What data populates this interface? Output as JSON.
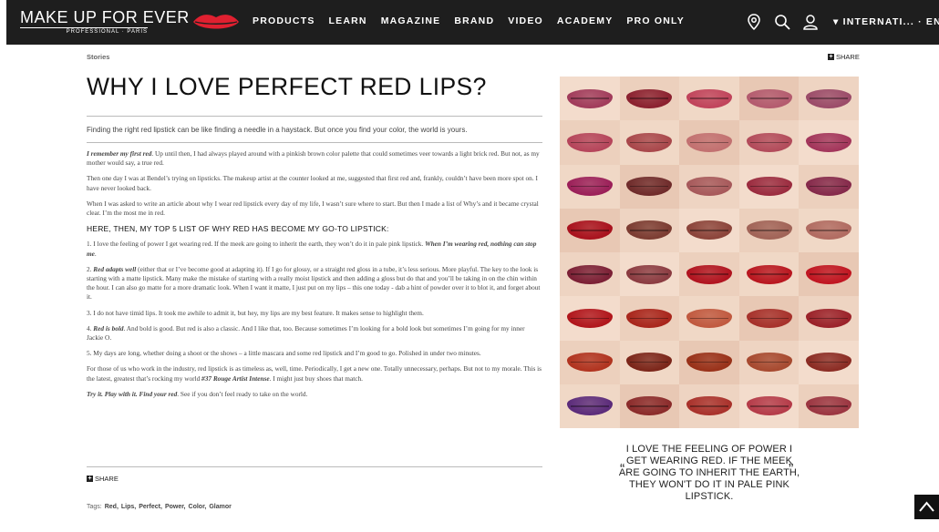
{
  "header": {
    "logo_main": "MAKE UP FOR EVER",
    "logo_sub": "PROFESSIONAL · PARIS",
    "nav": [
      "PRODUCTS",
      "LEARN",
      "MAGAZINE",
      "BRAND",
      "VIDEO",
      "ACADEMY",
      "PRO ONLY"
    ],
    "icons": [
      "location-pin-icon",
      "search-icon",
      "user-icon"
    ],
    "international": "▾ INTERNATI... · EN"
  },
  "article": {
    "breadcrumb": "Stories",
    "share_label": "SHARE",
    "title": "WHY I LOVE PERFECT RED LIPS?",
    "intro": "Finding the right red lipstick can be like finding a needle in a haystack. But once you find your color, the world is yours.",
    "paragraphs": [
      {
        "em": "I remember my first red",
        "text": ". Up until then, I had always played around with a pinkish brown color palette that could sometimes veer towards a light brick red. But not, as my mother would say, a true red."
      },
      {
        "em": "",
        "text": "Then one day I was at Bendel’s trying on lipsticks. The makeup artist at the counter looked at me, suggested that first red and, frankly, couldn’t have been more spot on. I have never looked back."
      },
      {
        "em": "",
        "text": "When I was asked to write an article about why I wear red lipstick every day of my life, I wasn’t sure where to start. But then I made a list of Why’s and it became crystal clear. I’m the most me in red."
      }
    ],
    "subheading": "HERE, THEN, MY TOP 5 LIST OF WHY RED HAS BECOME MY GO-TO LIPSTICK:",
    "list": [
      {
        "pre": "1. I love the feeling of power I get wearing red. If the meek are going to inherit the earth, they won’t do it in pale pink lipstick. ",
        "em": "When I’m wearing red, nothing can stop me",
        "post": "."
      },
      {
        "pre": "2. ",
        "em": "Red adapts well",
        "post": " (either that or I’ve become good at adapting it). If I go for glossy, or a straight red gloss in a tube, it’s less serious. More playful. The key to the look is starting with a matte lipstick. Many make the mistake of starting with a really moist lipstick and then adding a gloss but do that and you’ll be taking in on the chin within the hour. I can also go matte for a more dramatic look. When I want it matte, I just put on my lips – this one today  - dab a hint of powder over it to blot it, and forget about it."
      },
      {
        "pre": "3. I do not have timid lips. It took me awhile to admit it, but hey, my lips are my best feature. It makes sense to highlight them.",
        "em": "",
        "post": ""
      },
      {
        "pre": "4. ",
        "em": "Red is bold",
        "post": ". And bold is good. But red is also a classic. And I like that, too. Because sometimes I’m looking for a bold look but sometimes I’m going for my inner Jackie O."
      },
      {
        "pre": "5. My days are long, whether doing a shoot or the shows – a little mascara and some red lipstick and I’m good to go. Polished in under two minutes.",
        "em": "",
        "post": ""
      }
    ],
    "closing": {
      "pre": "For those of us who work in the industry, red lipstick is as timeless as, well, time. Periodically, I get a new one. Totally unnecessary, perhaps. But not to my morale. This is the latest, greatest that’s rocking my world  ",
      "em": "#37 Rouge Artist Intense",
      "post": ". I might just buy shoes that match."
    },
    "final": {
      "em": "Try it. Play with it. Find your red",
      "post": ". See if you don’t feel ready to take on the world."
    },
    "tags_label": "Tags:",
    "tags": [
      "Red,",
      "Lips,",
      "Perfect,",
      "Power,",
      "Color,",
      "Glamor"
    ]
  },
  "swatches": [
    "#a03a5a",
    "#8a1f2e",
    "#c0425a",
    "#b35a6e",
    "#9a4a68",
    "#b5445a",
    "#a8464a",
    "#c27070",
    "#b24a5a",
    "#a2345a",
    "#9a1e58",
    "#6e2a2a",
    "#a6585a",
    "#9a2a3e",
    "#84284a",
    "#a8101c",
    "#7a3a30",
    "#8a4238",
    "#a06256",
    "#b06a60",
    "#7a1e34",
    "#8a3a40",
    "#b0121e",
    "#b8151e",
    "#c01420",
    "#b0141a",
    "#a8241a",
    "#c0583e",
    "#a6302a",
    "#9a2028",
    "#b0321e",
    "#7a2418",
    "#983018",
    "#a6482e",
    "#8a2a22",
    "#5a2a7a",
    "#8a2a2a",
    "#a8302a",
    "#b43a48",
    "#9a3440"
  ],
  "quote": {
    "open": "“",
    "close": "”",
    "text": "I LOVE THE FEELING OF POWER I GET WEARING RED. IF THE MEEK ARE GOING TO INHERIT THE EARTH, THEY WON'T DO IT IN PALE PINK LIPSTICK."
  }
}
